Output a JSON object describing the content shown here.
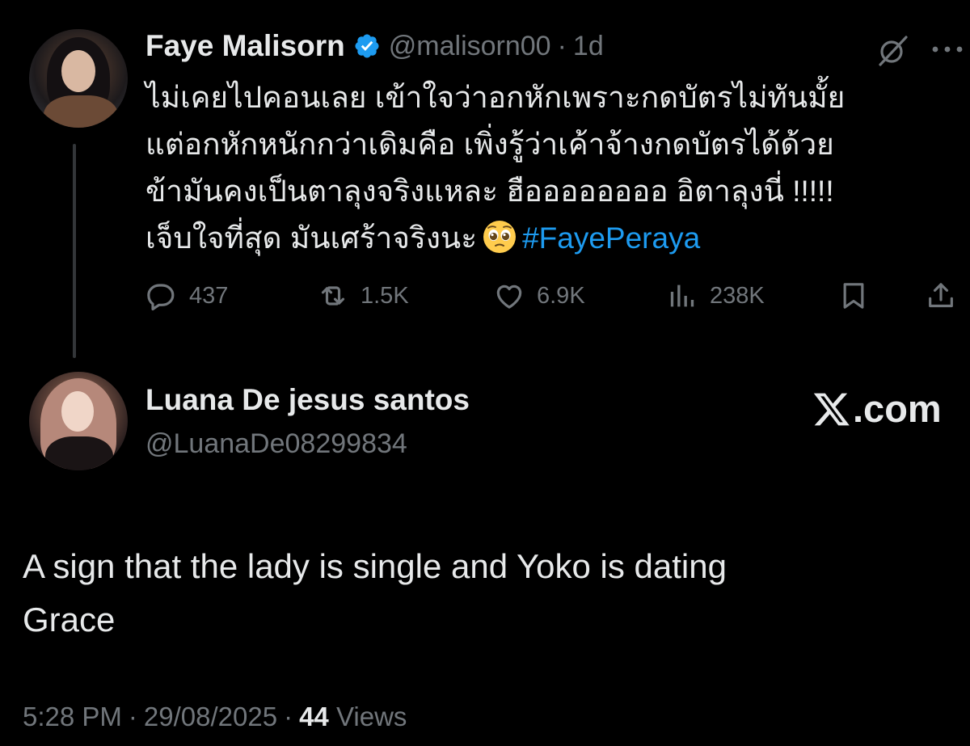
{
  "original_tweet": {
    "author": {
      "display_name": "Faye Malisorn",
      "handle": "@malisorn00",
      "verified": true,
      "avatar": "profile-photo"
    },
    "separator": "·",
    "time_ago": "1d",
    "icons": [
      "grok-icon",
      "more-icon"
    ],
    "text_lines": [
      "ไม่เคยไปคอนเลย เข้าใจว่าอกหักเพราะกดบัตรไม่ทันมั้ย",
      "แต่อกหักหนักกว่าเดิมคือ เพิ่งรู้ว่าเค้าจ้างกดบัตรได้ด้วย",
      "ข้ามันคงเป็นตาลุงจริงแหละ ฮืออออออออ อิตาลุงนี่ !!!!!",
      "เจ็บใจที่สุด มันเศร้าจริงนะ"
    ],
    "emoji": "pleading-face",
    "hashtag": "#FayePeraya",
    "actions": {
      "replies": "437",
      "reposts": "1.5K",
      "likes": "6.9K",
      "views": "238K"
    }
  },
  "reply_tweet": {
    "author": {
      "display_name": "Luana De jesus santos",
      "handle": "@LuanaDe08299834",
      "avatar": "profile-photo"
    },
    "source_label": ".com",
    "text_lines": [
      "A sign that the lady is single and Yoko is dating",
      "Grace"
    ],
    "time": "5:28 PM",
    "separator": "·",
    "date": "29/08/2025",
    "views_count": "44",
    "views_label": "Views"
  },
  "colors": {
    "background": "#000000",
    "primary_text": "#e7e9ea",
    "secondary_text": "#71767b",
    "accent": "#1d9bf0",
    "thread_line": "#333639"
  }
}
